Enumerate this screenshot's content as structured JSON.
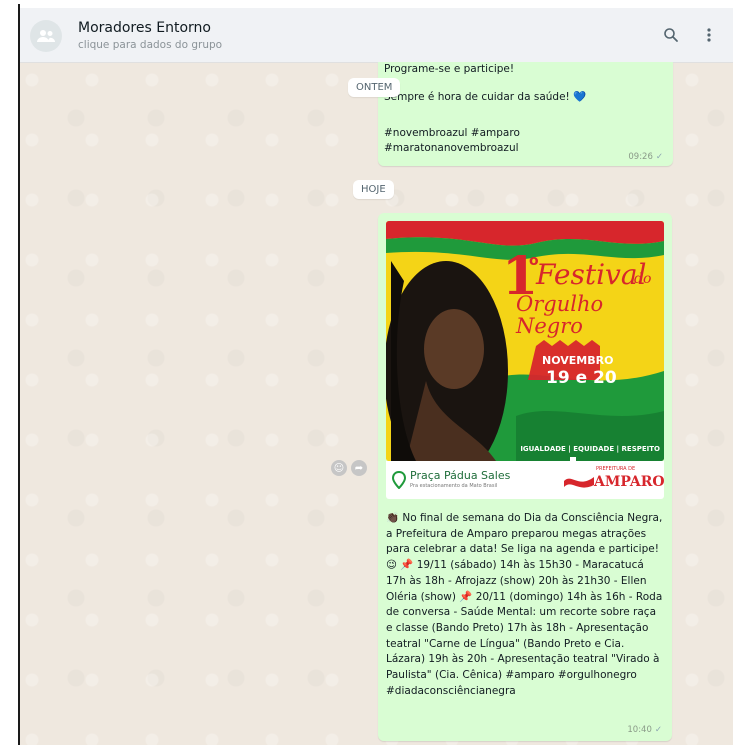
{
  "header": {
    "title": "Moradores Entorno",
    "subtitle": "clique para dados do grupo",
    "search_icon": "search-icon",
    "menu_icon": "kebab-menu-icon"
  },
  "dates": {
    "yesterday": "ONTEM",
    "today": "HOJE"
  },
  "msg1": {
    "line1": "Programe-se e participe!",
    "line2": "Sempre é hora de cuidar da saúde! 💙",
    "line3": "#novembroazul #amparo",
    "line4": "#maratonanovembroazul",
    "time": "09:26"
  },
  "msg2": {
    "poster": {
      "number": "1",
      "ordinal": "o",
      "title_line1": "Festival",
      "title_do": "do",
      "title_line2": "Orgulho Negro",
      "month": "NOVEMBRO",
      "days": "19 e 20",
      "footer": "IGUALDADE | EQUIDADE | RESPEITO"
    },
    "logo_left_name": "Praça Pádua Sales",
    "logo_left_sub": "Pra estacionamento da Mato Brasil",
    "logo_right_top": "PREFEITURA DE",
    "logo_right_name": "AMPARO",
    "text": "👏🏿 No final de semana do Dia da Consciência Negra, a Prefeitura de Amparo preparou megas atrações para celebrar a data!  Se liga na agenda e participe! 😉 📌 19/11 (sábado) 14h às 15h30 - Maracatucá  17h às 18h - Afrojazz (show)  20h às 21h30 - Ellen Oléria (show)  📌 20/11 (domingo) 14h às 16h - Roda de conversa - Saúde Mental: um recorte sobre raça e classe (Bando Preto)  17h às 18h - Apresentação teatral \"Carne de Língua\" (Bando Preto e Cia. Lázara)  19h às 20h - Apresentação teatral \"Virado à Paulista\" (Cia. Cênica)  #amparo #orgulhonegro #diadaconsciêncianegra",
    "time": "10:40"
  },
  "colors": {
    "header_bg": "#f0f2f5",
    "chat_bg": "#efe8df",
    "bubble_out": "#d9fdd3",
    "poster_yellow": "#f4d417",
    "poster_green": "#1f9a3b",
    "poster_red": "#d7262c"
  }
}
